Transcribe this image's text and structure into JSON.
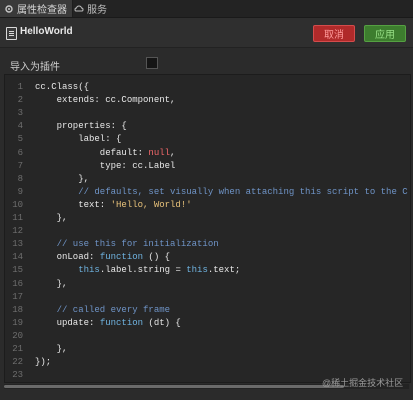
{
  "tabs": {
    "properties_label": "属性检查器",
    "services_label": "服务"
  },
  "header": {
    "title": "HelloWorld",
    "cancel_label": "取消",
    "apply_label": "应用"
  },
  "properties": {
    "import_as_plugin_label": "导入为插件",
    "import_as_plugin_checked": false
  },
  "editor": {
    "lines": [
      {
        "n": "1",
        "parts": [
          [
            "t",
            "cc.Class({"
          ]
        ]
      },
      {
        "n": "2",
        "parts": [
          [
            "t",
            "    extends: cc.Component,"
          ]
        ]
      },
      {
        "n": "3",
        "parts": [
          [
            "t",
            ""
          ]
        ]
      },
      {
        "n": "4",
        "parts": [
          [
            "t",
            "    properties: {"
          ]
        ]
      },
      {
        "n": "5",
        "parts": [
          [
            "t",
            "        label: {"
          ]
        ]
      },
      {
        "n": "6",
        "parts": [
          [
            "t",
            "            default: "
          ],
          [
            "num",
            "null"
          ],
          [
            "t",
            ","
          ]
        ]
      },
      {
        "n": "7",
        "parts": [
          [
            "t",
            "            type: cc.Label"
          ]
        ]
      },
      {
        "n": "8",
        "parts": [
          [
            "t",
            "        },"
          ]
        ]
      },
      {
        "n": "9",
        "parts": [
          [
            "cm",
            "        // defaults, set visually when attaching this script to the C"
          ]
        ]
      },
      {
        "n": "10",
        "parts": [
          [
            "t",
            "        text: "
          ],
          [
            "str",
            "'Hello, World!'"
          ]
        ]
      },
      {
        "n": "11",
        "parts": [
          [
            "t",
            "    },"
          ]
        ]
      },
      {
        "n": "12",
        "parts": [
          [
            "t",
            ""
          ]
        ]
      },
      {
        "n": "13",
        "parts": [
          [
            "cm",
            "    // use this for initialization"
          ]
        ]
      },
      {
        "n": "14",
        "parts": [
          [
            "t",
            "    onLoad: "
          ],
          [
            "kw",
            "function"
          ],
          [
            "t",
            " () {"
          ]
        ]
      },
      {
        "n": "15",
        "parts": [
          [
            "t",
            "        "
          ],
          [
            "kw",
            "this"
          ],
          [
            "t",
            ".label.string = "
          ],
          [
            "kw",
            "this"
          ],
          [
            "t",
            ".text;"
          ]
        ]
      },
      {
        "n": "16",
        "parts": [
          [
            "t",
            "    },"
          ]
        ]
      },
      {
        "n": "17",
        "parts": [
          [
            "t",
            ""
          ]
        ]
      },
      {
        "n": "18",
        "parts": [
          [
            "cm",
            "    // called every frame"
          ]
        ]
      },
      {
        "n": "19",
        "parts": [
          [
            "t",
            "    update: "
          ],
          [
            "kw",
            "function"
          ],
          [
            "t",
            " (dt) {"
          ]
        ]
      },
      {
        "n": "20",
        "parts": [
          [
            "t",
            ""
          ]
        ]
      },
      {
        "n": "21",
        "parts": [
          [
            "t",
            "    },"
          ]
        ]
      },
      {
        "n": "22",
        "parts": [
          [
            "t",
            "});"
          ]
        ]
      },
      {
        "n": "23",
        "parts": [
          [
            "t",
            ""
          ]
        ]
      }
    ]
  },
  "watermark": "@稀土掘金技术社区"
}
